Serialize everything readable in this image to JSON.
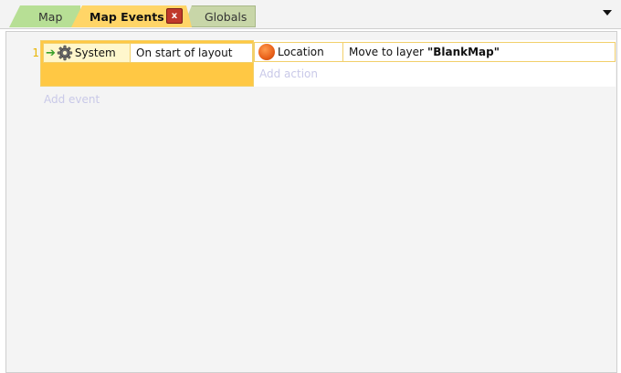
{
  "tabs": [
    {
      "label": "Map",
      "color": "#b7df95"
    },
    {
      "label": "Map Events",
      "active": true,
      "color": "#ffd567"
    },
    {
      "label": "Globals",
      "color": "#c8d6a8"
    }
  ],
  "tab_close_glyph": "x",
  "events": [
    {
      "number": "1",
      "condition": {
        "object": "System",
        "object_icon": "gear-icon",
        "text": "On start of layout"
      },
      "action": {
        "object": "Location",
        "object_icon": "orange-orb-icon",
        "text": "Move to layer",
        "value": "\"BlankMap\""
      },
      "add_action_label": "Add action"
    }
  ],
  "add_event_label": "Add event",
  "colors": {
    "event_accent": "#ffc844",
    "placeholder_text": "#c9c9e8",
    "event_number": "#e8b400"
  }
}
